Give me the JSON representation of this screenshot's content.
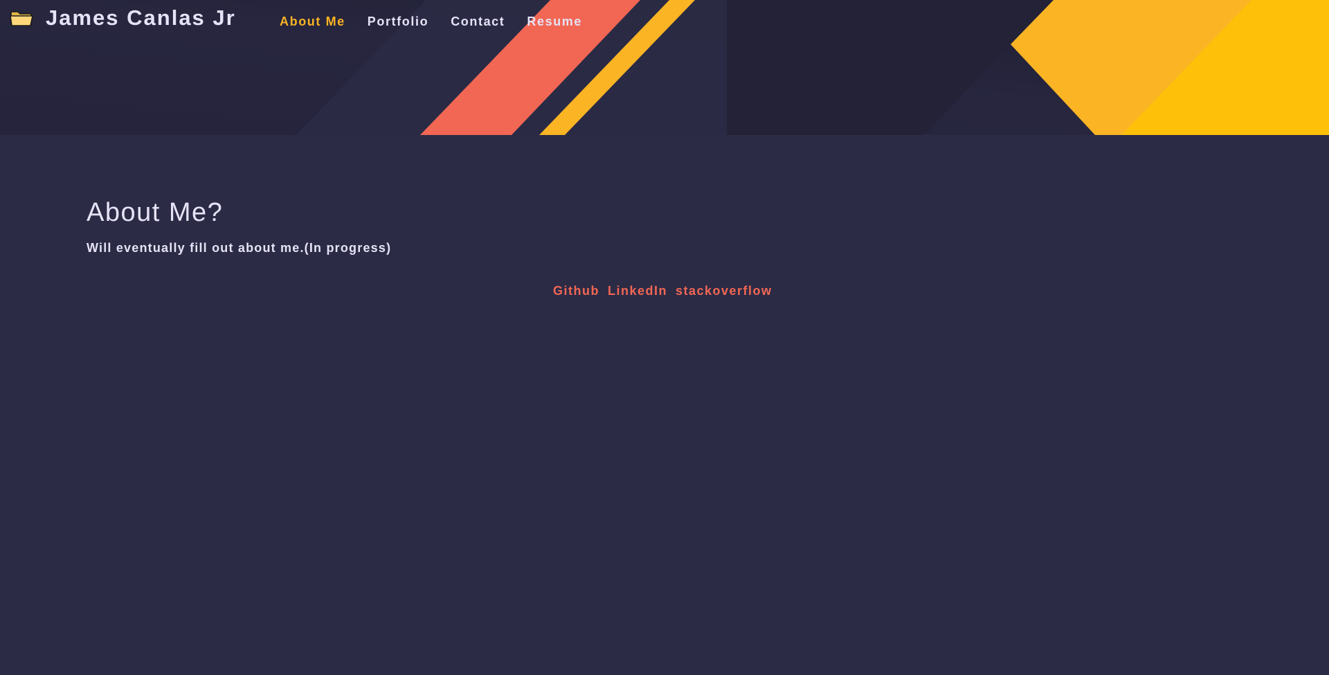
{
  "brand": {
    "icon": "folder-icon",
    "title": "James Canlas Jr"
  },
  "nav": {
    "items": [
      {
        "label": "About Me",
        "active": true
      },
      {
        "label": "Portfolio",
        "active": false
      },
      {
        "label": "Contact",
        "active": false
      },
      {
        "label": "Resume",
        "active": false
      }
    ]
  },
  "about": {
    "heading": "About Me?",
    "text": "Will eventually fill out about me.(In progress)"
  },
  "social": {
    "links": [
      {
        "label": "Github"
      },
      {
        "label": "LinkedIn"
      },
      {
        "label": "stackoverflow"
      }
    ]
  },
  "colors": {
    "background": "#2c2b45",
    "header_dark": "#22213a",
    "accent_coral": "#f26754",
    "accent_yellow": "#fbb424",
    "text_light": "#e6e3f7"
  }
}
